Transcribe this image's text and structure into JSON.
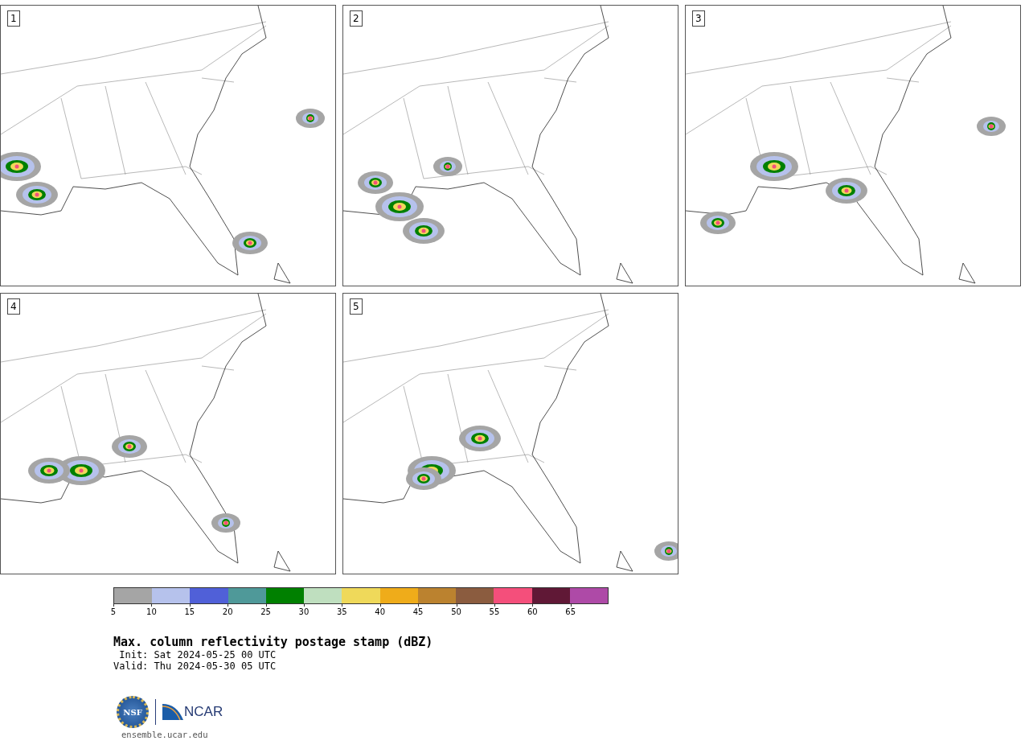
{
  "panels": [
    {
      "label": "1"
    },
    {
      "label": "2"
    },
    {
      "label": "3"
    },
    {
      "label": "4"
    },
    {
      "label": "5"
    }
  ],
  "colorbar": {
    "segments": [
      {
        "color": "#a5a5a5",
        "tick": "5"
      },
      {
        "color": "#b6c2ec",
        "tick": "10"
      },
      {
        "color": "#5060d8",
        "tick": "15"
      },
      {
        "color": "#4f9999",
        "tick": "20"
      },
      {
        "color": "#008000",
        "tick": "25"
      },
      {
        "color": "#bfdfbf",
        "tick": "30"
      },
      {
        "color": "#efd95a",
        "tick": "35"
      },
      {
        "color": "#efac1a",
        "tick": "40"
      },
      {
        "color": "#bb822f",
        "tick": "45"
      },
      {
        "color": "#8b5c3f",
        "tick": "50"
      },
      {
        "color": "#f44f7b",
        "tick": "55"
      },
      {
        "color": "#601836",
        "tick": "60"
      },
      {
        "color": "#ae4aa7",
        "tick": "65"
      }
    ]
  },
  "title": "Max. column reflectivity postage stamp (dBZ)",
  "init": " Init: Sat 2024-05-25 00 UTC",
  "valid": "Valid: Thu 2024-05-30 05 UTC",
  "logo": {
    "left": "NSF",
    "right": "NCAR"
  },
  "footer": "ensemble.ucar.edu"
}
